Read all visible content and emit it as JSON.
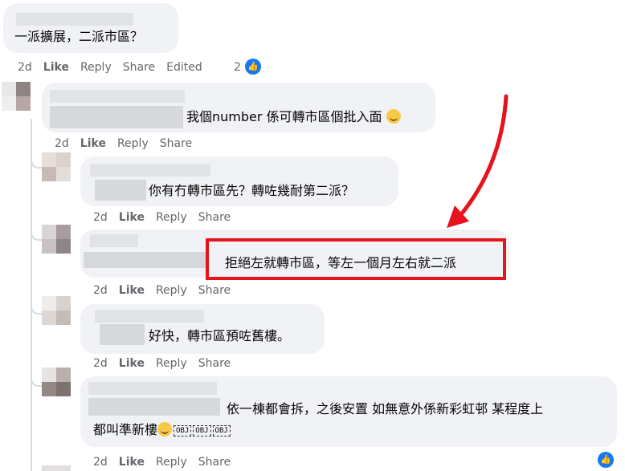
{
  "comments": [
    {
      "text": "一派擴展，二派市區？",
      "actions": {
        "time": "2d",
        "like": "Like",
        "reply": "Reply",
        "share": "Share",
        "edited": "Edited",
        "reaction_count": "2"
      }
    },
    {
      "text": "我個number 係可轉市區個批入面",
      "actions": {
        "time": "2d",
        "like": "Like",
        "reply": "Reply",
        "share": "Share"
      }
    },
    {
      "text": "你有冇轉市區先？轉咗幾耐第二派？",
      "actions": {
        "time": "2d",
        "like": "Like",
        "reply": "Reply",
        "share": "Share"
      }
    },
    {
      "text": "拒絕左就轉市區，等左一個月左右就二派",
      "actions": {
        "time": "2d",
        "like": "Like",
        "reply": "Reply",
        "share": "Share"
      }
    },
    {
      "text": "好快，轉市區預咗舊樓。",
      "actions": {
        "time": "2d",
        "like": "Like",
        "reply": "Reply",
        "share": "Share"
      }
    },
    {
      "text_line1": "依一棟都會拆，之後安置 如無意外係新彩虹邨 某程度上",
      "text_line2": "都叫準新樓",
      "obj_tags": [
        "OBJ",
        "OBJ",
        "OBJ"
      ],
      "actions": {
        "time": "2d",
        "like": "Like",
        "reply": "Reply",
        "share": "Share"
      }
    }
  ],
  "colors": {
    "annotation_red": "#e8121c",
    "facebook_blue": "#1877f2",
    "action_gray": "#65676b",
    "bubble_bg": "#f0f2f5"
  },
  "icons": [
    "like-thumb-icon",
    "emoji-icon",
    "annotation-arrow",
    "highlight-box"
  ]
}
